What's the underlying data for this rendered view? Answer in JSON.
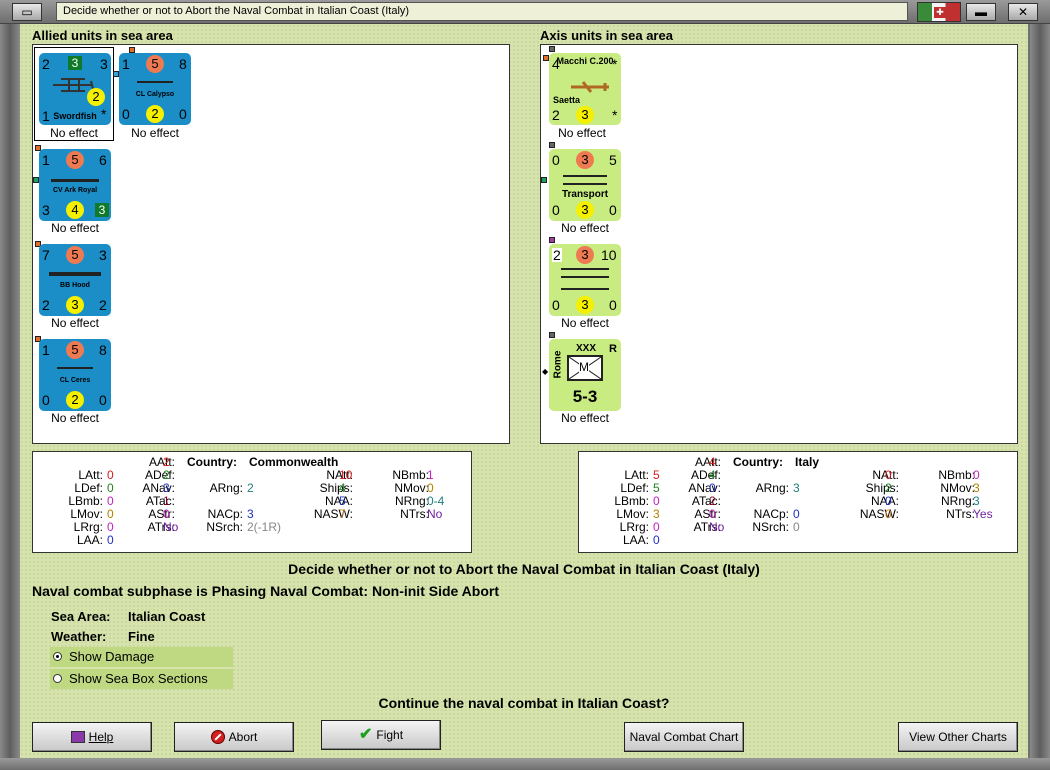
{
  "window": {
    "title": "Decide whether or not to Abort the Naval Combat in Italian Coast (Italy)"
  },
  "panels": {
    "allied_title": "Allied units in sea area",
    "axis_title": "Axis units in sea area"
  },
  "allied_units": [
    {
      "name": "Swordfish",
      "tl": "2",
      "tc": "3",
      "tr": "3",
      "bl": "1",
      "bc": "2",
      "br": "*",
      "effect": "No effect"
    },
    {
      "name": "CL Calypso",
      "tl": "1",
      "tc": "5",
      "tr": "8",
      "bl": "0",
      "bc": "2",
      "br": "0",
      "effect": "No effect"
    },
    {
      "name": "CV Ark Royal",
      "tl": "1",
      "tc": "5",
      "tr": "6",
      "bl": "3",
      "bc": "4",
      "br": "3",
      "effect": "No effect"
    },
    {
      "name": "BB Hood",
      "tl": "7",
      "tc": "5",
      "tr": "3",
      "bl": "2",
      "bc": "3",
      "br": "2",
      "effect": "No effect"
    },
    {
      "name": "CL Ceres",
      "tl": "1",
      "tc": "5",
      "tr": "8",
      "bl": "0",
      "bc": "2",
      "br": "0",
      "effect": "No effect"
    }
  ],
  "axis_units": [
    {
      "name": "Macchi C.200",
      "sub": "Saetta",
      "tl": "4",
      "tr": "*",
      "bl": "2",
      "bc": "3",
      "br": "*",
      "effect": "No effect"
    },
    {
      "name": "Transport",
      "tl": "0",
      "tc": "3",
      "tr": "5",
      "bl": "0",
      "bc": "3",
      "br": "0",
      "effect": "No effect"
    },
    {
      "name": "",
      "tl": "2",
      "tc": "3",
      "tr": "10",
      "bl": "0",
      "bc": "3",
      "br": "0",
      "effect": "No effect"
    },
    {
      "name": "Rome",
      "corps": "XXX",
      "res": "R",
      "type": "M",
      "strength": "5-3",
      "effect": "No effect"
    }
  ],
  "allied_stats": {
    "country_label": "Country:",
    "country": "Commonwealth",
    "rows": [
      {
        "k": "LAtt:",
        "v": "0",
        "c": "#d02020"
      },
      {
        "k": "LDef:",
        "v": "0",
        "c": "#208020"
      },
      {
        "k": "LBmb:",
        "v": "0",
        "c": "#c020c0"
      },
      {
        "k": "LMov:",
        "v": "0",
        "c": "#b08000"
      },
      {
        "k": "LRrg:",
        "v": "0",
        "c": "#c020c0"
      },
      {
        "k": "LAA:",
        "v": "0",
        "c": "#2030c0"
      }
    ],
    "rows2": [
      {
        "k": "AAtt:",
        "v": "2",
        "c": "#d02020"
      },
      {
        "k": "ADef:",
        "v": "2",
        "c": "#208020"
      },
      {
        "k": "ANav:",
        "v": "3",
        "c": "#2030c0"
      },
      {
        "k": "ATac:",
        "v": "1",
        "c": "#800020"
      },
      {
        "k": "AStr:",
        "v": "0",
        "c": "#c020c0"
      },
      {
        "k": "ATrs:",
        "v": "No",
        "c": "#7020a0"
      }
    ],
    "rows3": [
      {
        "k": "ARng:",
        "v": "2",
        "c": "#208080"
      },
      {
        "k": "NACp:",
        "v": "3",
        "c": "#2030c0"
      },
      {
        "k": "NSrch:",
        "v": "2(-1R)",
        "c": "#888888"
      }
    ],
    "rows4": [
      {
        "k": "NAtt:",
        "v": "10",
        "c": "#d02020"
      },
      {
        "k": "Ships:",
        "v": "4",
        "c": "#208020"
      },
      {
        "k": "NAA:",
        "v": "5",
        "c": "#2030c0"
      },
      {
        "k": "NASW:",
        "v": "7",
        "c": "#d08020"
      }
    ],
    "rows5": [
      {
        "k": "NBmb:",
        "v": "1",
        "c": "#c020c0"
      },
      {
        "k": "NMov:",
        "v": "0",
        "c": "#b08000"
      },
      {
        "k": "NRng:",
        "v": "0-4",
        "c": "#208080"
      },
      {
        "k": "NTrs:",
        "v": "No",
        "c": "#7020a0"
      }
    ]
  },
  "axis_stats": {
    "country_label": "Country:",
    "country": "Italy",
    "rows": [
      {
        "k": "LAtt:",
        "v": "5",
        "c": "#d02020"
      },
      {
        "k": "LDef:",
        "v": "5",
        "c": "#208020"
      },
      {
        "k": "LBmb:",
        "v": "0",
        "c": "#c020c0"
      },
      {
        "k": "LMov:",
        "v": "3",
        "c": "#b08000"
      },
      {
        "k": "LRrg:",
        "v": "0",
        "c": "#c020c0"
      },
      {
        "k": "LAA:",
        "v": "0",
        "c": "#2030c0"
      }
    ],
    "rows2": [
      {
        "k": "AAtt:",
        "v": "4",
        "c": "#d02020"
      },
      {
        "k": "ADef:",
        "v": "4",
        "c": "#208020"
      },
      {
        "k": "ANav:",
        "v": "0",
        "c": "#2030c0"
      },
      {
        "k": "ATac:",
        "v": "2",
        "c": "#800020"
      },
      {
        "k": "AStr:",
        "v": "0",
        "c": "#c020c0"
      },
      {
        "k": "ATrs:",
        "v": "No",
        "c": "#7020a0"
      }
    ],
    "rows3": [
      {
        "k": "ARng:",
        "v": "3",
        "c": "#208080"
      },
      {
        "k": "NACp:",
        "v": "0",
        "c": "#2030c0"
      },
      {
        "k": "NSrch:",
        "v": "0",
        "c": "#888888"
      }
    ],
    "rows4": [
      {
        "k": "NAtt:",
        "v": "0",
        "c": "#d02020"
      },
      {
        "k": "Ships:",
        "v": "2",
        "c": "#208020"
      },
      {
        "k": "NAA:",
        "v": "0",
        "c": "#2030c0"
      },
      {
        "k": "NASW:",
        "v": "0",
        "c": "#d08020"
      }
    ],
    "rows5": [
      {
        "k": "NBmb:",
        "v": "0",
        "c": "#c020c0"
      },
      {
        "k": "NMov:",
        "v": "3",
        "c": "#b08000"
      },
      {
        "k": "NRng:",
        "v": "3",
        "c": "#208080"
      },
      {
        "k": "NTrs:",
        "v": "Yes",
        "c": "#7020a0"
      }
    ]
  },
  "info": {
    "decide": "Decide whether or not to Abort the Naval Combat in Italian Coast (Italy)",
    "subphase": "Naval combat subphase is Phasing Naval Combat: Non-init Side Abort",
    "sea_area_label": "Sea Area:",
    "sea_area": "Italian Coast",
    "weather_label": "Weather:",
    "weather": "Fine",
    "show_damage": "Show Damage",
    "show_sections": "Show Sea Box Sections",
    "question": "Continue the naval combat in Italian Coast?"
  },
  "buttons": {
    "help": "Help",
    "abort": "Abort",
    "fight": "Fight",
    "chart": "Naval Combat Chart",
    "other": "View Other Charts"
  }
}
